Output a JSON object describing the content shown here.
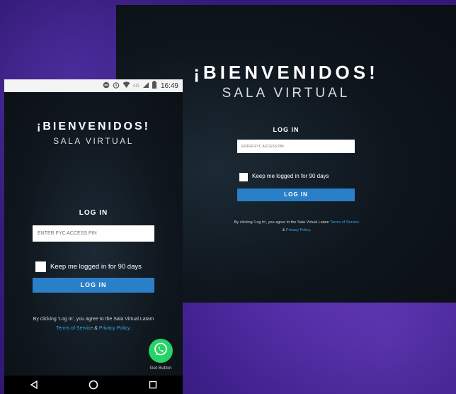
{
  "desktop": {
    "title": "¡BIENVENIDOS!",
    "subtitle": "SALA VIRTUAL",
    "login_heading": "LOG IN",
    "pin_placeholder": "ENTER FYC ACCESS PIN",
    "keep_logged_label": "Keep me logged in for 90 days",
    "login_button": "LOG IN",
    "terms_prefix": "By clicking 'Log In', you agree to the Sala Virtual Latam",
    "terms_link": "Terms of Service",
    "terms_and": "&",
    "privacy_link": "Privacy Policy",
    "terms_suffix": "."
  },
  "phone": {
    "status_time": "16:49",
    "status_network": "4G",
    "title": "¡BIENVENIDOS!",
    "subtitle": "SALA VIRTUAL",
    "login_heading": "LOG IN",
    "pin_placeholder": "ENTER FYC ACCESS PIN",
    "keep_logged_label": "Keep me logged in for 90 days",
    "login_button": "LOG IN",
    "terms_prefix": "By clicking 'Log In', you agree to the Sala Virtual Latam",
    "terms_link": "Terms of Service",
    "terms_and": "&",
    "privacy_link": "Privacy Policy",
    "terms_suffix": ".",
    "whatsapp_label": "Get Button"
  },
  "colors": {
    "accent_button": "#2a7fc9",
    "link": "#35a6e0",
    "whatsapp": "#25d366",
    "background_purple": "#3d1f8a"
  },
  "icons": [
    "alarm-icon",
    "wifi-icon",
    "signal-icon",
    "battery-icon",
    "whatsapp-icon",
    "back-icon",
    "home-icon",
    "recents-icon"
  ]
}
